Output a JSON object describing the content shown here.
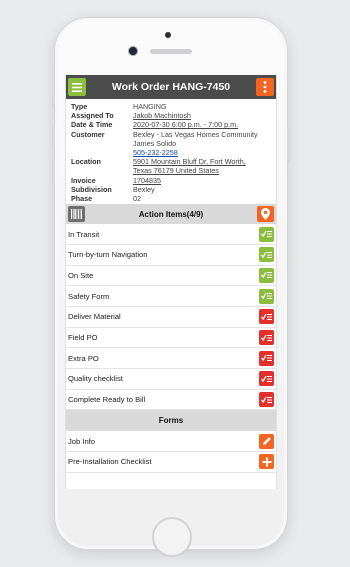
{
  "header": {
    "title": "Work Order HANG-7450"
  },
  "details": [
    {
      "label": "Type",
      "value": "HANGING",
      "style": "plain"
    },
    {
      "label": "Assigned To",
      "value": "Jakob Machintosh",
      "style": "ul"
    },
    {
      "label": "Date & Time",
      "value": "2020-07-30 6:00 p.m. - 7:00 p.m.",
      "style": "ul"
    },
    {
      "label": "Customer",
      "value": "Bexley - Las Vegas Homes Community",
      "style": "plain"
    },
    {
      "label": "",
      "value": "James Solido",
      "style": "plain"
    },
    {
      "label": "",
      "value": "505-232-2258",
      "style": "link"
    },
    {
      "label": "Location",
      "value": "5901 Mountain Bluff Dr, Fort Worth,",
      "style": "ul"
    },
    {
      "label": "",
      "value": "Texas 76179 United States",
      "style": "ul"
    },
    {
      "label": "Invoice",
      "value": "1704835",
      "style": "ul"
    },
    {
      "label": "Subdivision",
      "value": "Bexley",
      "style": "plain"
    },
    {
      "label": "Phase",
      "value": "02",
      "style": "plain"
    }
  ],
  "action_items": {
    "title": "Action Items(4/9)",
    "items": [
      {
        "label": "In Transit",
        "status": "green"
      },
      {
        "label": "Turn-by-turn Navigation",
        "status": "green"
      },
      {
        "label": "On Site",
        "status": "green"
      },
      {
        "label": "Safety Form",
        "status": "green"
      },
      {
        "label": "Deliver Material",
        "status": "red"
      },
      {
        "label": "Field PO",
        "status": "red"
      },
      {
        "label": "Extra PO",
        "status": "red"
      },
      {
        "label": "Quality checklist",
        "status": "red"
      },
      {
        "label": "Complete Ready to Bill",
        "status": "red"
      }
    ]
  },
  "forms": {
    "title": "Forms",
    "items": [
      {
        "label": "Job Info",
        "icon": "pencil-icon"
      },
      {
        "label": "Pre-Installation Checklist",
        "icon": "plus-icon"
      }
    ]
  },
  "colors": {
    "green": "#8bbd3f",
    "red": "#e3302a",
    "orange": "#f26522",
    "topbar": "#4b4b4b"
  }
}
